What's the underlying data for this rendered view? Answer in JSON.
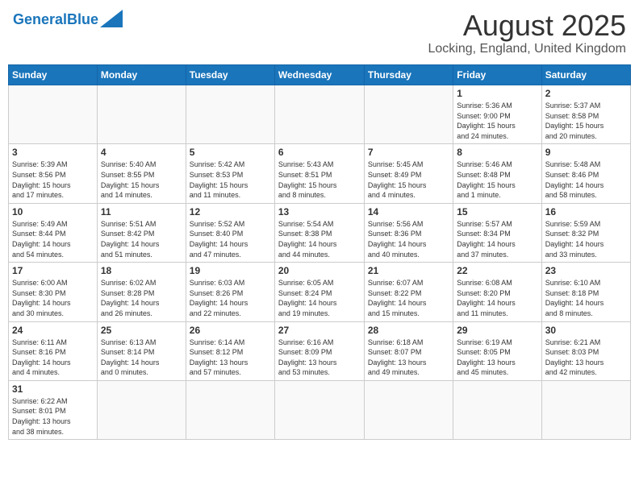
{
  "header": {
    "logo_general": "General",
    "logo_blue": "Blue",
    "month": "August 2025",
    "location": "Locking, England, United Kingdom"
  },
  "weekdays": [
    "Sunday",
    "Monday",
    "Tuesday",
    "Wednesday",
    "Thursday",
    "Friday",
    "Saturday"
  ],
  "weeks": [
    [
      {
        "day": "",
        "info": ""
      },
      {
        "day": "",
        "info": ""
      },
      {
        "day": "",
        "info": ""
      },
      {
        "day": "",
        "info": ""
      },
      {
        "day": "",
        "info": ""
      },
      {
        "day": "1",
        "info": "Sunrise: 5:36 AM\nSunset: 9:00 PM\nDaylight: 15 hours\nand 24 minutes."
      },
      {
        "day": "2",
        "info": "Sunrise: 5:37 AM\nSunset: 8:58 PM\nDaylight: 15 hours\nand 20 minutes."
      }
    ],
    [
      {
        "day": "3",
        "info": "Sunrise: 5:39 AM\nSunset: 8:56 PM\nDaylight: 15 hours\nand 17 minutes."
      },
      {
        "day": "4",
        "info": "Sunrise: 5:40 AM\nSunset: 8:55 PM\nDaylight: 15 hours\nand 14 minutes."
      },
      {
        "day": "5",
        "info": "Sunrise: 5:42 AM\nSunset: 8:53 PM\nDaylight: 15 hours\nand 11 minutes."
      },
      {
        "day": "6",
        "info": "Sunrise: 5:43 AM\nSunset: 8:51 PM\nDaylight: 15 hours\nand 8 minutes."
      },
      {
        "day": "7",
        "info": "Sunrise: 5:45 AM\nSunset: 8:49 PM\nDaylight: 15 hours\nand 4 minutes."
      },
      {
        "day": "8",
        "info": "Sunrise: 5:46 AM\nSunset: 8:48 PM\nDaylight: 15 hours\nand 1 minute."
      },
      {
        "day": "9",
        "info": "Sunrise: 5:48 AM\nSunset: 8:46 PM\nDaylight: 14 hours\nand 58 minutes."
      }
    ],
    [
      {
        "day": "10",
        "info": "Sunrise: 5:49 AM\nSunset: 8:44 PM\nDaylight: 14 hours\nand 54 minutes."
      },
      {
        "day": "11",
        "info": "Sunrise: 5:51 AM\nSunset: 8:42 PM\nDaylight: 14 hours\nand 51 minutes."
      },
      {
        "day": "12",
        "info": "Sunrise: 5:52 AM\nSunset: 8:40 PM\nDaylight: 14 hours\nand 47 minutes."
      },
      {
        "day": "13",
        "info": "Sunrise: 5:54 AM\nSunset: 8:38 PM\nDaylight: 14 hours\nand 44 minutes."
      },
      {
        "day": "14",
        "info": "Sunrise: 5:56 AM\nSunset: 8:36 PM\nDaylight: 14 hours\nand 40 minutes."
      },
      {
        "day": "15",
        "info": "Sunrise: 5:57 AM\nSunset: 8:34 PM\nDaylight: 14 hours\nand 37 minutes."
      },
      {
        "day": "16",
        "info": "Sunrise: 5:59 AM\nSunset: 8:32 PM\nDaylight: 14 hours\nand 33 minutes."
      }
    ],
    [
      {
        "day": "17",
        "info": "Sunrise: 6:00 AM\nSunset: 8:30 PM\nDaylight: 14 hours\nand 30 minutes."
      },
      {
        "day": "18",
        "info": "Sunrise: 6:02 AM\nSunset: 8:28 PM\nDaylight: 14 hours\nand 26 minutes."
      },
      {
        "day": "19",
        "info": "Sunrise: 6:03 AM\nSunset: 8:26 PM\nDaylight: 14 hours\nand 22 minutes."
      },
      {
        "day": "20",
        "info": "Sunrise: 6:05 AM\nSunset: 8:24 PM\nDaylight: 14 hours\nand 19 minutes."
      },
      {
        "day": "21",
        "info": "Sunrise: 6:07 AM\nSunset: 8:22 PM\nDaylight: 14 hours\nand 15 minutes."
      },
      {
        "day": "22",
        "info": "Sunrise: 6:08 AM\nSunset: 8:20 PM\nDaylight: 14 hours\nand 11 minutes."
      },
      {
        "day": "23",
        "info": "Sunrise: 6:10 AM\nSunset: 8:18 PM\nDaylight: 14 hours\nand 8 minutes."
      }
    ],
    [
      {
        "day": "24",
        "info": "Sunrise: 6:11 AM\nSunset: 8:16 PM\nDaylight: 14 hours\nand 4 minutes."
      },
      {
        "day": "25",
        "info": "Sunrise: 6:13 AM\nSunset: 8:14 PM\nDaylight: 14 hours\nand 0 minutes."
      },
      {
        "day": "26",
        "info": "Sunrise: 6:14 AM\nSunset: 8:12 PM\nDaylight: 13 hours\nand 57 minutes."
      },
      {
        "day": "27",
        "info": "Sunrise: 6:16 AM\nSunset: 8:09 PM\nDaylight: 13 hours\nand 53 minutes."
      },
      {
        "day": "28",
        "info": "Sunrise: 6:18 AM\nSunset: 8:07 PM\nDaylight: 13 hours\nand 49 minutes."
      },
      {
        "day": "29",
        "info": "Sunrise: 6:19 AM\nSunset: 8:05 PM\nDaylight: 13 hours\nand 45 minutes."
      },
      {
        "day": "30",
        "info": "Sunrise: 6:21 AM\nSunset: 8:03 PM\nDaylight: 13 hours\nand 42 minutes."
      }
    ],
    [
      {
        "day": "31",
        "info": "Sunrise: 6:22 AM\nSunset: 8:01 PM\nDaylight: 13 hours\nand 38 minutes."
      },
      {
        "day": "",
        "info": ""
      },
      {
        "day": "",
        "info": ""
      },
      {
        "day": "",
        "info": ""
      },
      {
        "day": "",
        "info": ""
      },
      {
        "day": "",
        "info": ""
      },
      {
        "day": "",
        "info": ""
      }
    ]
  ]
}
